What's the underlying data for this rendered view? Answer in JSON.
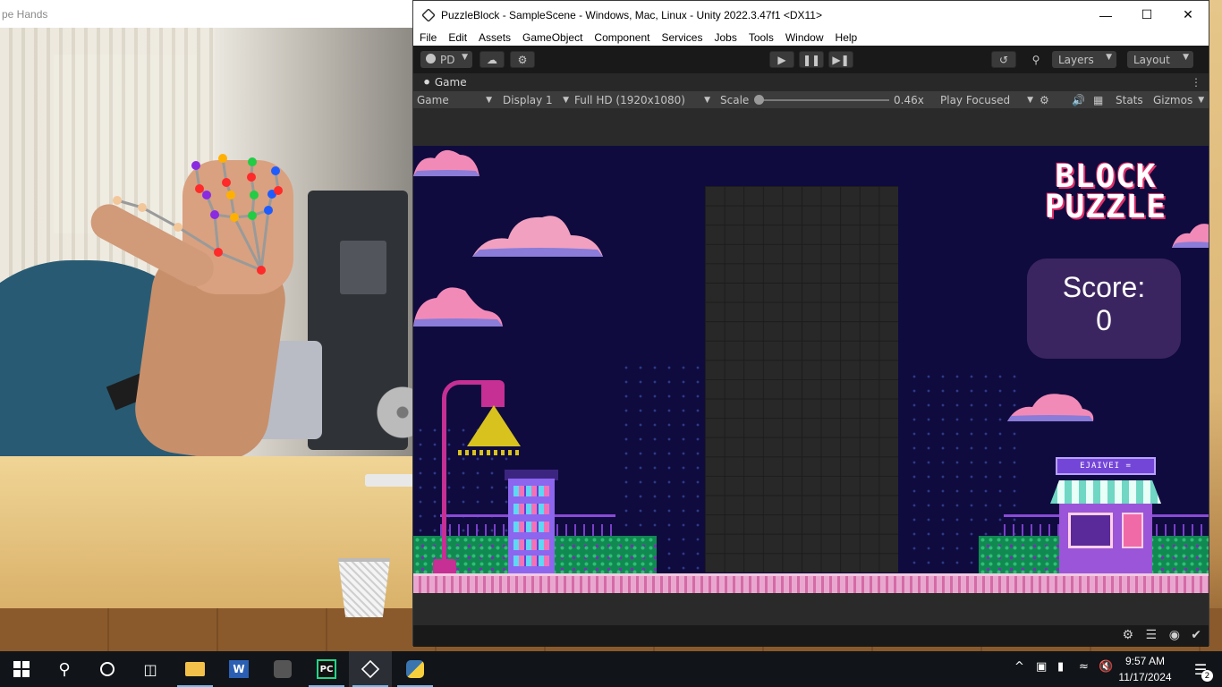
{
  "camera_window": {
    "title": "pe Hands"
  },
  "unity": {
    "title": "PuzzleBlock - SampleScene - Windows, Mac, Linux - Unity 2022.3.47f1 <DX11>",
    "menu": [
      "File",
      "Edit",
      "Assets",
      "GameObject",
      "Component",
      "Services",
      "Jobs",
      "Tools",
      "Window",
      "Help"
    ],
    "toolbar": {
      "account": "PD",
      "layers": "Layers",
      "layout": "Layout"
    },
    "tab": "Game",
    "gamebar": {
      "view": "Game",
      "display": "Display 1",
      "resolution": "Full HD (1920x1080)",
      "scale_label": "Scale",
      "scale_value": "0.46x",
      "play_mode": "Play Focused",
      "stats": "Stats",
      "gizmos": "Gizmos"
    },
    "scale_fraction": 0.0
  },
  "game": {
    "title_line1": "BLOCK",
    "title_line2": "PUZZLE",
    "score_label": "Score:",
    "score_value": "0",
    "shop_sign": "EJAIVEI ="
  },
  "taskbar": {
    "time": "9:57 AM",
    "date": "11/17/2024",
    "notifications": "2"
  },
  "colors": {
    "game_background": "#0f0b3f",
    "board": "#282828",
    "score_panel": "#3b2560",
    "title_accent": "#e0306a"
  }
}
